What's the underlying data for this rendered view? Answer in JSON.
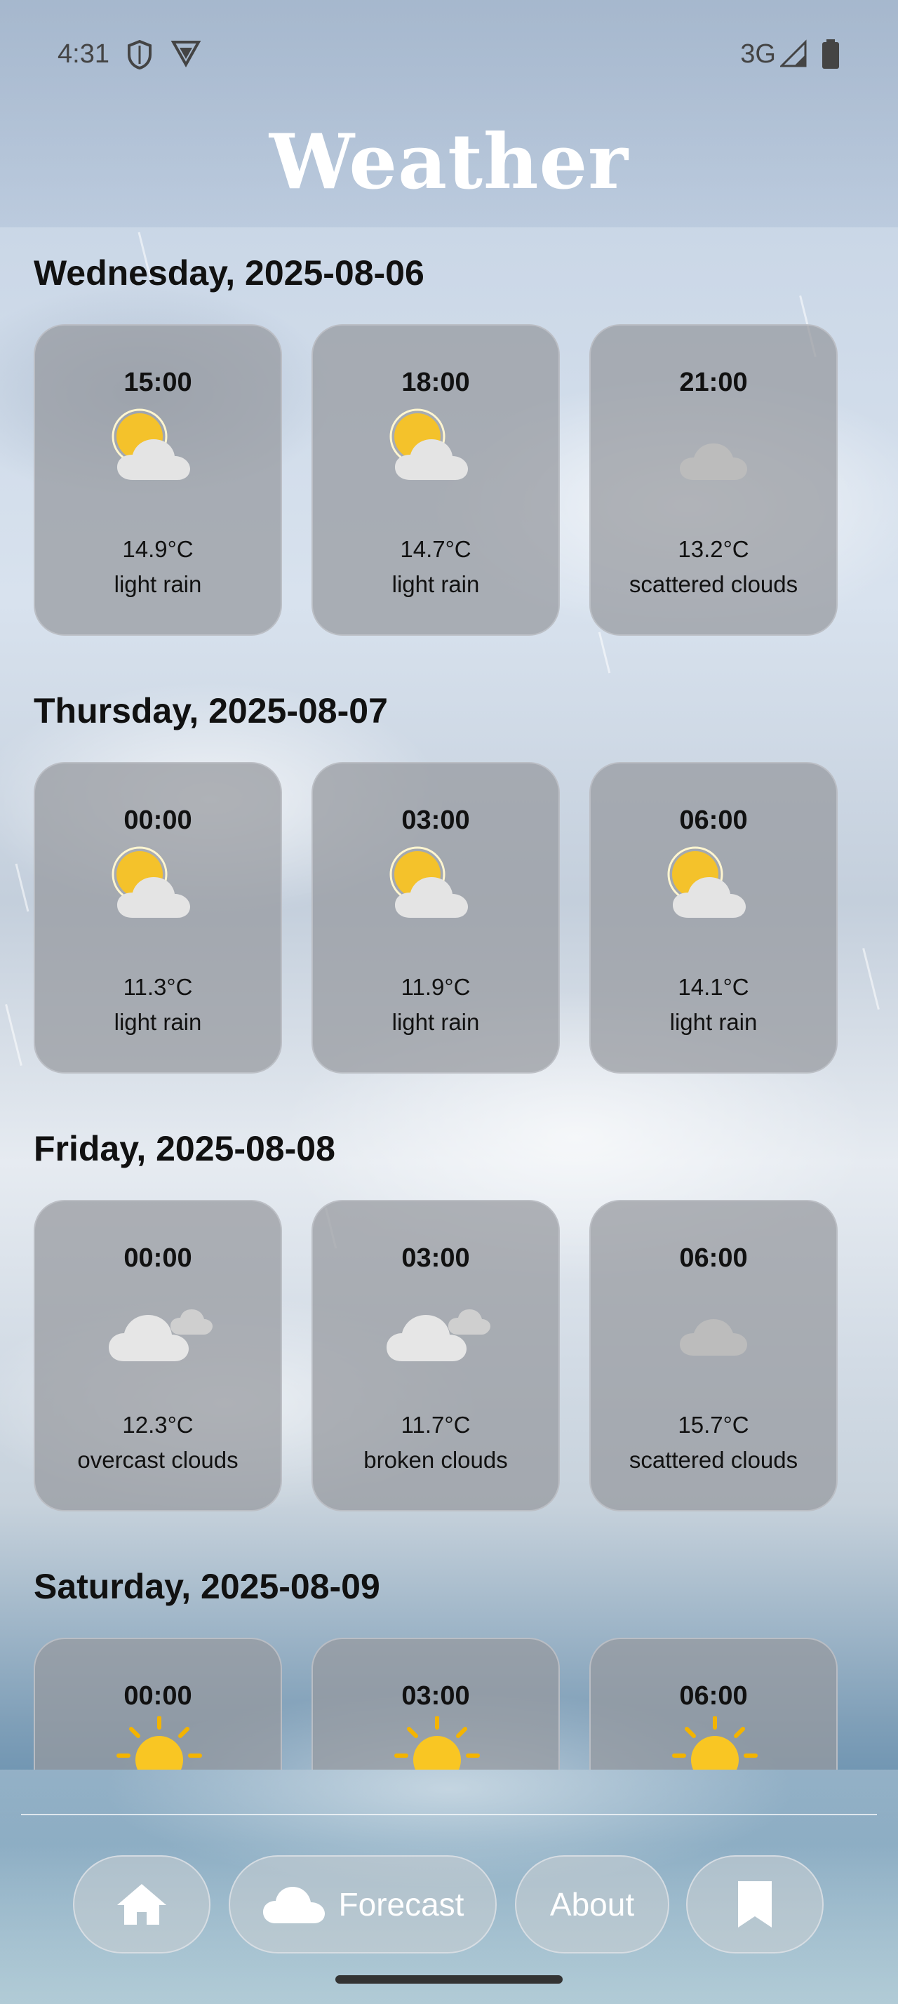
{
  "status": {
    "time": "4:31",
    "network": "3G"
  },
  "app": {
    "title": "Weather"
  },
  "days": [
    {
      "label": "Wednesday, 2025-08-06",
      "entries": [
        {
          "time": "15:00",
          "temp": "14.9°C",
          "desc": "light rain",
          "icon": "sun-cloud-icon"
        },
        {
          "time": "18:00",
          "temp": "14.7°C",
          "desc": "light rain",
          "icon": "sun-cloud-icon"
        },
        {
          "time": "21:00",
          "temp": "13.2°C",
          "desc": "scattered clouds",
          "icon": "cloud-icon"
        }
      ]
    },
    {
      "label": "Thursday, 2025-08-07",
      "entries": [
        {
          "time": "00:00",
          "temp": "11.3°C",
          "desc": "light rain",
          "icon": "sun-cloud-icon"
        },
        {
          "time": "03:00",
          "temp": "11.9°C",
          "desc": "light rain",
          "icon": "sun-cloud-icon"
        },
        {
          "time": "06:00",
          "temp": "14.1°C",
          "desc": "light rain",
          "icon": "sun-cloud-icon"
        }
      ]
    },
    {
      "label": "Friday, 2025-08-08",
      "entries": [
        {
          "time": "00:00",
          "temp": "12.3°C",
          "desc": "overcast clouds",
          "icon": "clouds-icon"
        },
        {
          "time": "03:00",
          "temp": "11.7°C",
          "desc": "broken clouds",
          "icon": "clouds-icon"
        },
        {
          "time": "06:00",
          "temp": "15.7°C",
          "desc": "scattered clouds",
          "icon": "cloud-icon"
        }
      ]
    },
    {
      "label": "Saturday, 2025-08-09",
      "entries": [
        {
          "time": "00:00",
          "icon": "sun-icon"
        },
        {
          "time": "03:00",
          "icon": "sun-icon"
        },
        {
          "time": "06:00",
          "icon": "sun-icon"
        }
      ]
    }
  ],
  "nav": {
    "forecast_label": "Forecast",
    "about_label": "About"
  }
}
